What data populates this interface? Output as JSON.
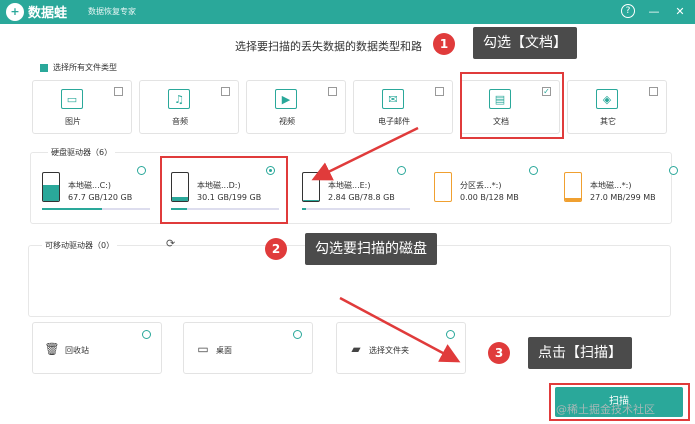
{
  "app": {
    "name": "数据蛙",
    "subtitle": "数据恢复专家",
    "logo_glyph": "+",
    "help_icon": "?",
    "minimize_icon": "—",
    "close_icon": "✕"
  },
  "prompt": "选择要扫描的丢失数据的数据类型和路",
  "select_all_label": "选择所有文件类型",
  "file_types": [
    {
      "label": "图片",
      "icon": "image-icon",
      "glyph": "▭",
      "checked": false
    },
    {
      "label": "音频",
      "icon": "music-icon",
      "glyph": "♫",
      "checked": false
    },
    {
      "label": "视频",
      "icon": "video-icon",
      "glyph": "▶",
      "checked": false
    },
    {
      "label": "电子邮件",
      "icon": "email-icon",
      "glyph": "✉",
      "checked": false
    },
    {
      "label": "文档",
      "icon": "document-icon",
      "glyph": "▤",
      "checked": true
    },
    {
      "label": "其它",
      "icon": "other-icon",
      "glyph": "◈",
      "checked": false
    }
  ],
  "hdd": {
    "title": "硬盘驱动器（6）",
    "drives": [
      {
        "name": "本地磁...C:)",
        "size": "67.7 GB/120 GB",
        "selected": false,
        "used_fraction": 0.56,
        "color": "#2aa89a"
      },
      {
        "name": "本地磁...D:)",
        "size": "30.1 GB/199 GB",
        "selected": true,
        "used_fraction": 0.15,
        "color": "#2aa89a"
      },
      {
        "name": "本地磁...E:)",
        "size": "2.84 GB/78.8 GB",
        "selected": false,
        "used_fraction": 0.04,
        "color": "#2aa89a"
      },
      {
        "name": "分区丢...*:)",
        "size": "0.00  B/128 MB",
        "selected": false,
        "used_fraction": 0.0,
        "color": "#f0a030"
      },
      {
        "name": "本地磁...*:)",
        "size": "27.0 MB/299 MB",
        "selected": false,
        "used_fraction": 0.09,
        "color": "#f0a030"
      }
    ]
  },
  "removable": {
    "title": "可移动驱动器（0）",
    "refresh_icon": "⟳"
  },
  "locations": [
    {
      "label": "回收站",
      "icon": "trash-icon",
      "glyph": "🗑"
    },
    {
      "label": "桌面",
      "icon": "desktop-icon",
      "glyph": "▭"
    },
    {
      "label": "选择文件夹",
      "icon": "folder-icon",
      "glyph": "▰"
    }
  ],
  "scan_button": "扫描",
  "watermark": "@稀土掘金技术社区",
  "annotations": [
    {
      "number": "1",
      "text": "勾选【文档】"
    },
    {
      "number": "2",
      "text": "勾选要扫描的磁盘"
    },
    {
      "number": "3",
      "text": "点击【扫描】"
    }
  ],
  "colors": {
    "accent": "#2aa89a",
    "highlight": "#e03b3b",
    "callout_bg": "#4b4b4b"
  }
}
